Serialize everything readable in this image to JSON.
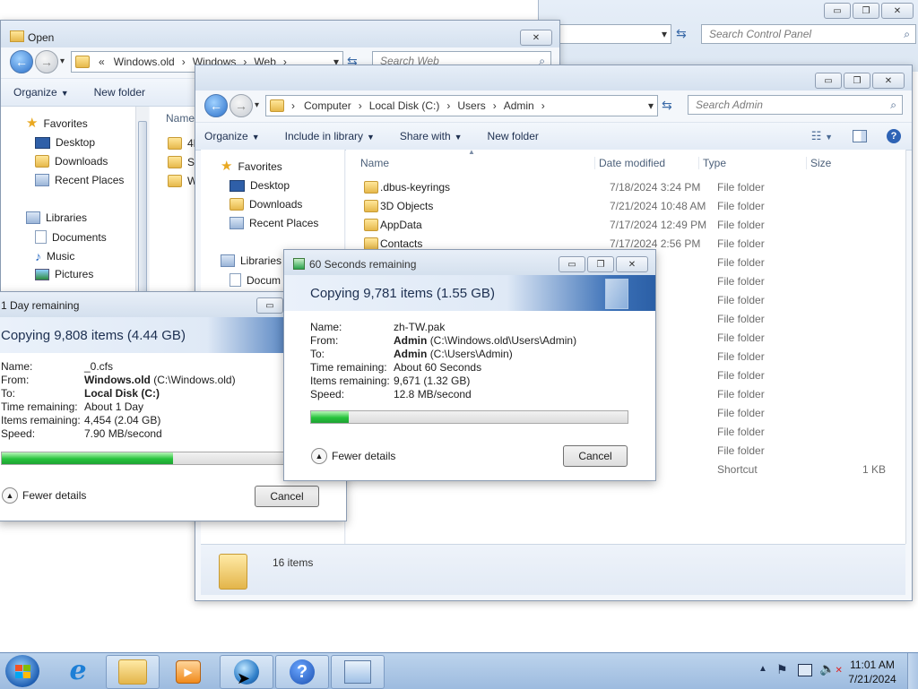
{
  "background_window": {
    "search_placeholder": "Search Control Panel",
    "buttons": {
      "minimize": "▭",
      "maximize": "❐",
      "close": "✕"
    }
  },
  "open_dialog": {
    "title": "Open",
    "breadcrumb": [
      "«",
      "Windows.old",
      "Windows",
      "Web"
    ],
    "search_placeholder": "Search Web",
    "toolbar": {
      "organize": "Organize",
      "new_folder": "New folder"
    },
    "nav": {
      "favorites": "Favorites",
      "desktop": "Desktop",
      "downloads": "Downloads",
      "recent": "Recent Places",
      "libraries": "Libraries",
      "documents": "Documents",
      "music": "Music",
      "pictures": "Pictures"
    },
    "column_name": "Name",
    "files": [
      "4K",
      "Sc",
      "W"
    ]
  },
  "explorer": {
    "breadcrumb": [
      "Computer",
      "Local Disk (C:)",
      "Users",
      "Admin"
    ],
    "search_placeholder": "Search Admin",
    "toolbar": {
      "organize": "Organize",
      "include_in_library": "Include in library",
      "share_with": "Share with",
      "new_folder": "New folder"
    },
    "nav": {
      "favorites": "Favorites",
      "desktop": "Desktop",
      "downloads": "Downloads",
      "recent": "Recent Places",
      "libraries": "Libraries",
      "documents": "Docum"
    },
    "columns": {
      "name": "Name",
      "date": "Date modified",
      "type": "Type",
      "size": "Size"
    },
    "rows": [
      {
        "name": ".dbus-keyrings",
        "date": "7/18/2024 3:24 PM",
        "type": "File folder",
        "size": ""
      },
      {
        "name": "3D Objects",
        "date": "7/21/2024 10:48 AM",
        "type": "File folder",
        "size": ""
      },
      {
        "name": "AppData",
        "date": "7/17/2024 12:49 PM",
        "type": "File folder",
        "size": ""
      },
      {
        "name": "Contacts",
        "date": "7/17/2024 2:56 PM",
        "type": "File folder",
        "size": ""
      },
      {
        "name": "",
        "date": "48 AM",
        "type": "File folder",
        "size": ""
      },
      {
        "name": "",
        "date": "48 AM",
        "type": "File folder",
        "size": ""
      },
      {
        "name": "",
        "date": "48 AM",
        "type": "File folder",
        "size": ""
      },
      {
        "name": "",
        "date": "6 PM",
        "type": "File folder",
        "size": ""
      },
      {
        "name": "",
        "date": "48 AM",
        "type": "File folder",
        "size": ""
      },
      {
        "name": "",
        "date": "6 PM",
        "type": "File folder",
        "size": ""
      },
      {
        "name": "",
        "date": "48 AM",
        "type": "File folder",
        "size": ""
      },
      {
        "name": "",
        "date": "48 AM",
        "type": "File folder",
        "size": ""
      },
      {
        "name": "",
        "date": "48 AM",
        "type": "File folder",
        "size": ""
      },
      {
        "name": "",
        "date": "6 PM",
        "type": "File folder",
        "size": ""
      },
      {
        "name": "",
        "date": "6 PM",
        "type": "File folder",
        "size": ""
      },
      {
        "name": "",
        "date": "00 AM",
        "type": "Shortcut",
        "size": "1 KB"
      }
    ],
    "status": "16 items"
  },
  "copy_dialog_1": {
    "title": "1 Day remaining",
    "heading": "Copying 9,808 items (4.44 GB)",
    "labels": {
      "name": "Name:",
      "from": "From:",
      "to": "To:",
      "time": "Time remaining:",
      "items": "Items remaining:",
      "speed": "Speed:"
    },
    "name": "_0.cfs",
    "from_bold": "Windows.old",
    "from_path": "(C:\\Windows.old)",
    "to_bold": "Local Disk (C:)",
    "time": "About 1 Day",
    "items": "4,454 (2.04 GB)",
    "speed": "7.90 MB/second",
    "progress": 0.6,
    "fewer_details": "Fewer details",
    "cancel": "Cancel"
  },
  "copy_dialog_2": {
    "title": "60 Seconds remaining",
    "heading": "Copying 9,781 items (1.55 GB)",
    "labels": {
      "name": "Name:",
      "from": "From:",
      "to": "To:",
      "time": "Time remaining:",
      "items": "Items remaining:",
      "speed": "Speed:"
    },
    "name": "zh-TW.pak",
    "from_bold": "Admin",
    "from_path": "(C:\\Windows.old\\Users\\Admin)",
    "to_bold": "Admin",
    "to_path": "(C:\\Users\\Admin)",
    "time": "About 60 Seconds",
    "items": "9,671 (1.32 GB)",
    "speed": "12.8 MB/second",
    "progress": 0.12,
    "fewer_details": "Fewer details",
    "cancel": "Cancel"
  },
  "taskbar": {
    "time": "11:01 AM",
    "date": "7/21/2024"
  }
}
